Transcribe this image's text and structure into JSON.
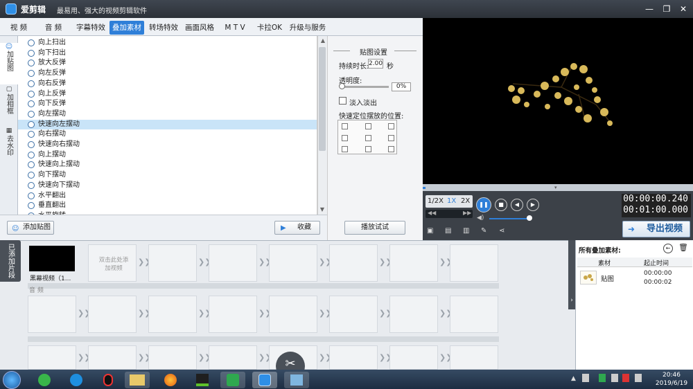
{
  "app": {
    "title": "爱剪辑",
    "slogan": "最易用、强大的视频剪辑软件",
    "win": {
      "minimize": "—",
      "restore": "❐",
      "close": "✕"
    }
  },
  "tabs": [
    "视 频",
    "音 频",
    "字幕特效",
    "叠加素材",
    "转场特效",
    "画面风格",
    "M T V",
    "卡拉OK",
    "升级与服务"
  ],
  "active_tab": "叠加素材",
  "side_tabs": [
    "加贴图",
    "加相框",
    "去水印"
  ],
  "effects": [
    "向上扫出",
    "向下扫出",
    "放大反弹",
    "向左反弹",
    "向右反弹",
    "向上反弹",
    "向下反弹",
    "向左摆动",
    "快速向左摆动",
    "向右摆动",
    "快速向右摆动",
    "向上摆动",
    "快速向上摆动",
    "向下摆动",
    "快速向下摆动",
    "水平翻出",
    "垂直翻出",
    "水平旋转"
  ],
  "selected_effect": "快速向左摆动",
  "settings": {
    "title": "贴图设置",
    "duration_label": "持续时长:",
    "duration_value": "2.00",
    "duration_unit": "秒",
    "opacity_label": "透明度:",
    "opacity_value": "0%",
    "fade_label": "淡入淡出",
    "position_label": "快速定位摆放的位置:",
    "preview_btn": "播放试试"
  },
  "left_buttons": {
    "add_sticker": "添加贴图",
    "favorite": "收藏"
  },
  "player": {
    "speeds": [
      "1/2X",
      "1X",
      "2X"
    ],
    "active_speed": "1X",
    "time_current": "00:00:00.240",
    "time_total": "00:01:00.000",
    "export": "导出视频"
  },
  "timeline": {
    "label": "已添加片段",
    "clip_name": "黑幕视频（1...",
    "add_hint": "双击此处添加视频",
    "audio_label": "音 频"
  },
  "right_panel": {
    "title": "所有叠加素材:",
    "col_material": "素材",
    "col_time": "起止时间",
    "item_name": "贴图",
    "item_start": "00:00:00",
    "item_end": "00:00:02"
  },
  "taskbar": {
    "time": "20:46",
    "date": "2019/6/19"
  }
}
